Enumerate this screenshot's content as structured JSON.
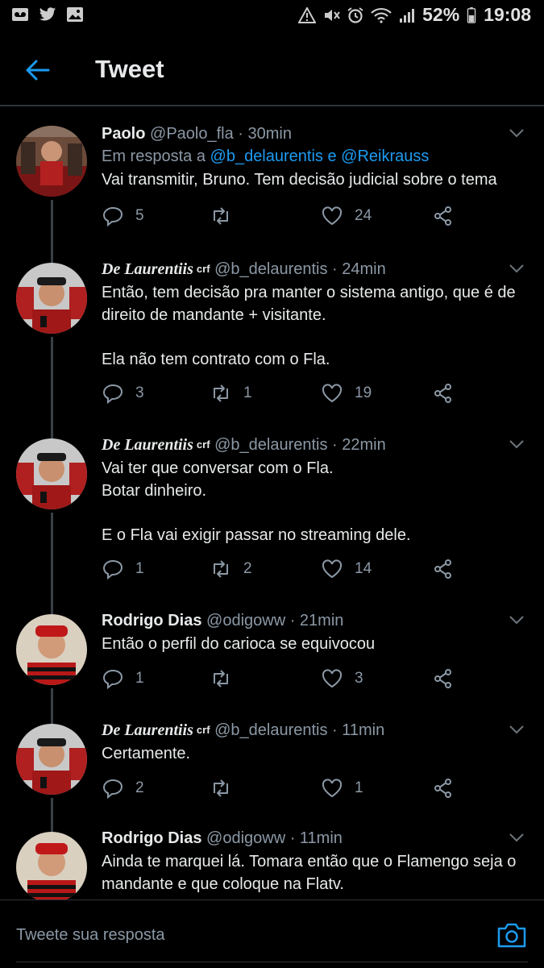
{
  "status_bar": {
    "battery": "52%",
    "time": "19:08",
    "icons": [
      "voicemail-icon",
      "twitter-icon",
      "image-icon",
      "warning-icon",
      "mute-icon",
      "alarm-icon",
      "wifi-icon",
      "signal-icon",
      "battery-icon"
    ]
  },
  "header": {
    "title": "Tweet",
    "back_icon": "arrow-left-icon"
  },
  "tweets": [
    {
      "name": "Paolo",
      "handle": "@Paolo_fla",
      "time": "· 30min",
      "reply_prefix": "Em resposta a",
      "reply_to": "@b_delaurentis e @Reikrauss",
      "text": "Vai transmitir, Bruno. Tem decisão judicial sobre o tema",
      "replies": "5",
      "retweets": "",
      "likes": "24"
    },
    {
      "name": "De Laurentiis",
      "badge": "crf",
      "handle": "@b_delaurentis",
      "time": "· 24min",
      "text": "Então, tem decisão pra manter o sistema antigo, que é de direito de mandante + visitante.\n\nEla não tem contrato com o Fla.",
      "replies": "3",
      "retweets": "1",
      "likes": "19"
    },
    {
      "name": "De Laurentiis",
      "badge": "crf",
      "handle": "@b_delaurentis",
      "time": "· 22min",
      "text": "Vai ter que conversar com o Fla.\nBotar dinheiro.\n\nE o Fla vai exigir passar no streaming dele.",
      "replies": "1",
      "retweets": "2",
      "likes": "14"
    },
    {
      "name": "Rodrigo Dias",
      "handle": "@odigoww",
      "time": "· 21min",
      "text": "Então o perfil do carioca se equivocou",
      "replies": "1",
      "retweets": "",
      "likes": "3"
    },
    {
      "name": "De Laurentiis",
      "badge": "crf",
      "handle": "@b_delaurentis",
      "time": "· 11min",
      "text": "Certamente.",
      "replies": "2",
      "retweets": "",
      "likes": "1"
    },
    {
      "name": "Rodrigo Dias",
      "handle": "@odigoww",
      "time": "· 11min",
      "text": "Ainda te marquei lá. Tomara então que o Flamengo seja o mandante e que coloque na Flatv."
    }
  ],
  "composer": {
    "placeholder": "Tweete sua resposta",
    "camera_icon": "camera-icon"
  },
  "colors": {
    "background": "#000000",
    "accent": "#1d9bf0",
    "muted": "#8b98a5",
    "text": "#e7e9ea"
  }
}
